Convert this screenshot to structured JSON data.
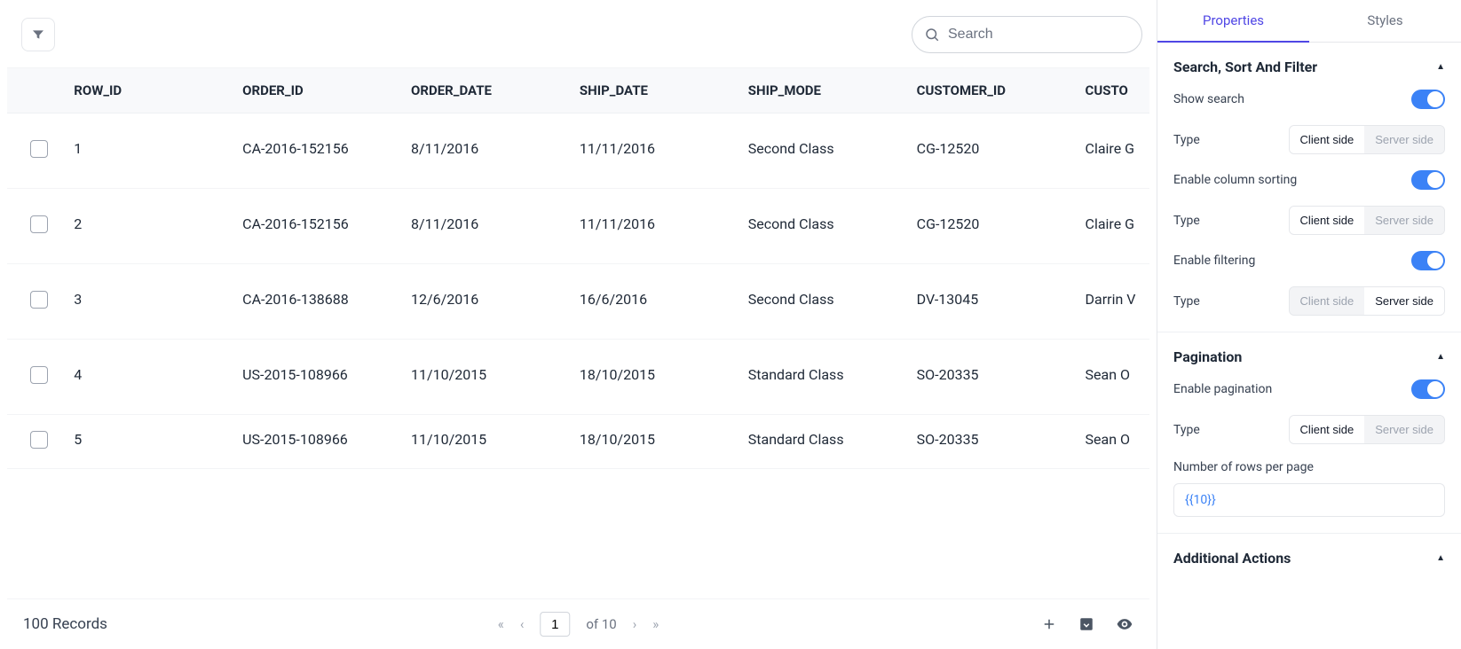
{
  "search": {
    "placeholder": "Search"
  },
  "table": {
    "headers": [
      "ROW_ID",
      "ORDER_ID",
      "ORDER_DATE",
      "SHIP_DATE",
      "SHIP_MODE",
      "CUSTOMER_ID",
      "CUSTOMER_NAME"
    ],
    "header_truncated_last": "CUSTO",
    "rows": [
      {
        "row_id": "1",
        "order_id": "CA-2016-152156",
        "order_date": "8/11/2016",
        "ship_date": "11/11/2016",
        "ship_mode": "Second Class",
        "customer_id": "CG-12520",
        "customer_name": "Claire G"
      },
      {
        "row_id": "2",
        "order_id": "CA-2016-152156",
        "order_date": "8/11/2016",
        "ship_date": "11/11/2016",
        "ship_mode": "Second Class",
        "customer_id": "CG-12520",
        "customer_name": "Claire G"
      },
      {
        "row_id": "3",
        "order_id": "CA-2016-138688",
        "order_date": "12/6/2016",
        "ship_date": "16/6/2016",
        "ship_mode": "Second Class",
        "customer_id": "DV-13045",
        "customer_name": "Darrin V"
      },
      {
        "row_id": "4",
        "order_id": "US-2015-108966",
        "order_date": "11/10/2015",
        "ship_date": "18/10/2015",
        "ship_mode": "Standard Class",
        "customer_id": "SO-20335",
        "customer_name": "Sean O"
      },
      {
        "row_id": "5",
        "order_id": "US-2015-108966",
        "order_date": "11/10/2015",
        "ship_date": "18/10/2015",
        "ship_mode": "Standard Class",
        "customer_id": "SO-20335",
        "customer_name": "Sean O"
      }
    ]
  },
  "footer": {
    "records_label": "100 Records",
    "page_value": "1",
    "of_label": "of 10"
  },
  "panel": {
    "tabs": {
      "properties": "Properties",
      "styles": "Styles"
    },
    "section1": {
      "title": "Search, Sort And Filter",
      "show_search_label": "Show search",
      "show_search_on": true,
      "type_label": "Type",
      "seg_client": "Client side",
      "seg_server": "Server side",
      "type1_active": "client",
      "enable_sorting_label": "Enable column sorting",
      "enable_sorting_on": true,
      "type2_active": "client",
      "enable_filtering_label": "Enable filtering",
      "enable_filtering_on": true,
      "type3_active": "server"
    },
    "section2": {
      "title": "Pagination",
      "enable_pagination_label": "Enable pagination",
      "enable_pagination_on": true,
      "type_active": "client",
      "rows_per_page_label": "Number of rows per page",
      "rows_per_page_value": "{{10}}"
    },
    "section3": {
      "title": "Additional Actions"
    }
  }
}
